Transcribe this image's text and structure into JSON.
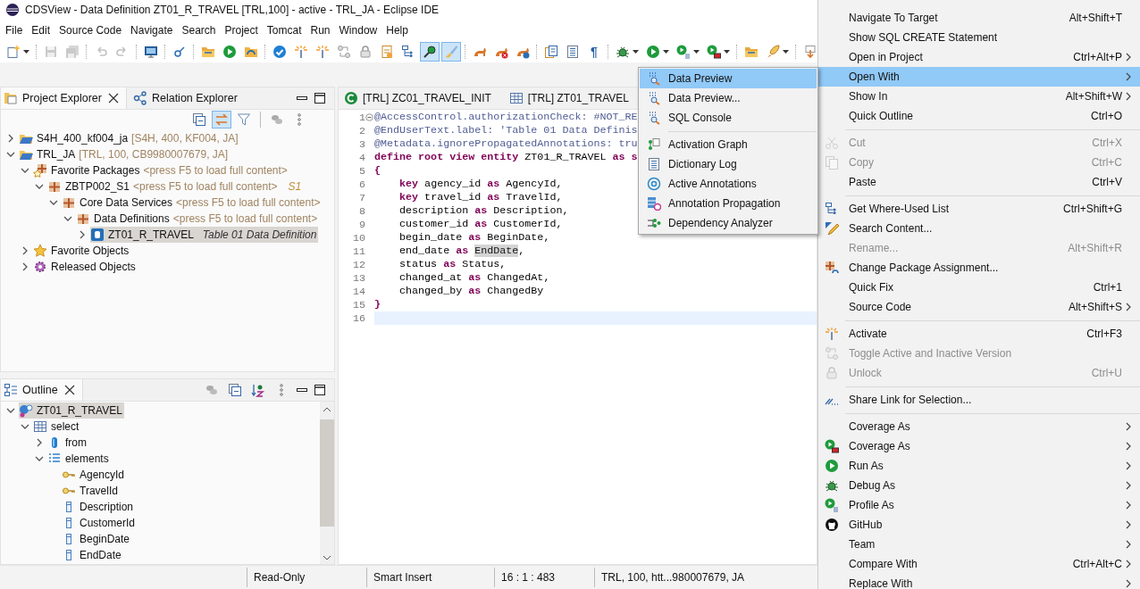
{
  "window": {
    "title": "CDSView - Data Definition ZT01_R_TRAVEL [TRL,100] - active - TRL_JA - Eclipse IDE"
  },
  "menu_bar": [
    "File",
    "Edit",
    "Source Code",
    "Navigate",
    "Search",
    "Project",
    "Tomcat",
    "Run",
    "Window",
    "Help"
  ],
  "toolbar": [
    {
      "kind": "newfile",
      "dropdown": true,
      "selected": false,
      "disabled": false
    },
    {
      "kind": "separator"
    },
    {
      "kind": "save",
      "dropdown": false,
      "selected": false,
      "disabled": true
    },
    {
      "kind": "saveall",
      "dropdown": false,
      "selected": false,
      "disabled": true
    },
    {
      "kind": "separator"
    },
    {
      "kind": "undo",
      "dropdown": false,
      "selected": false,
      "disabled": true
    },
    {
      "kind": "redo",
      "dropdown": false,
      "selected": false,
      "disabled": true
    },
    {
      "kind": "separator"
    },
    {
      "kind": "monitor",
      "dropdown": false,
      "selected": false,
      "disabled": false
    },
    {
      "kind": "separator"
    },
    {
      "kind": "link",
      "dropdown": false,
      "selected": false,
      "disabled": false
    },
    {
      "kind": "separator"
    },
    {
      "kind": "folder",
      "dropdown": false,
      "selected": false,
      "disabled": false
    },
    {
      "kind": "play",
      "dropdown": false,
      "selected": false,
      "disabled": false
    },
    {
      "kind": "foldersync",
      "dropdown": false,
      "selected": false,
      "disabled": false
    },
    {
      "kind": "separator"
    },
    {
      "kind": "check",
      "dropdown": false,
      "selected": false,
      "disabled": false
    },
    {
      "kind": "sparkle",
      "dropdown": false,
      "selected": false,
      "disabled": false
    },
    {
      "kind": "sparkle",
      "dropdown": false,
      "selected": false,
      "disabled": false
    },
    {
      "kind": "cycle",
      "dropdown": false,
      "selected": false,
      "disabled": false
    },
    {
      "kind": "lock",
      "dropdown": false,
      "selected": false,
      "disabled": false
    },
    {
      "kind": "docorange",
      "dropdown": false,
      "selected": false,
      "disabled": false
    },
    {
      "kind": "hierarchy",
      "dropdown": false,
      "selected": false,
      "disabled": false
    },
    {
      "kind": "searchtool",
      "dropdown": false,
      "selected": true,
      "disabled": false
    },
    {
      "kind": "brush",
      "dropdown": false,
      "selected": true,
      "disabled": false
    },
    {
      "kind": "separator"
    },
    {
      "kind": "cat",
      "dropdown": false,
      "selected": false,
      "disabled": false
    },
    {
      "kind": "catx",
      "dropdown": false,
      "selected": false,
      "disabled": false
    },
    {
      "kind": "catblue",
      "dropdown": false,
      "selected": false,
      "disabled": false
    },
    {
      "kind": "separator"
    },
    {
      "kind": "docs2",
      "dropdown": false,
      "selected": false,
      "disabled": false
    },
    {
      "kind": "listdoc",
      "dropdown": false,
      "selected": false,
      "disabled": false
    },
    {
      "kind": "text",
      "label": "¶",
      "dropdown": false,
      "selected": false,
      "disabled": false
    },
    {
      "kind": "separator"
    },
    {
      "kind": "bug",
      "dropdown": true,
      "selected": false,
      "disabled": false
    },
    {
      "kind": "play",
      "dropdown": true,
      "selected": false,
      "disabled": false
    },
    {
      "kind": "playdoc",
      "dropdown": true,
      "selected": false,
      "disabled": false
    },
    {
      "kind": "playred",
      "dropdown": true,
      "selected": false,
      "disabled": false
    },
    {
      "kind": "separator"
    },
    {
      "kind": "folder",
      "dropdown": false,
      "selected": false,
      "disabled": false
    },
    {
      "kind": "rocket",
      "dropdown": true,
      "selected": false,
      "disabled": false
    },
    {
      "kind": "separator"
    },
    {
      "kind": "down",
      "dropdown": true,
      "selected": false,
      "disabled": false
    }
  ],
  "project_explorer": {
    "tabs": [
      {
        "label": "Project Explorer",
        "kind": "explorer",
        "selected": true,
        "closable": true
      },
      {
        "label": "Relation Explorer",
        "kind": "relation",
        "selected": false,
        "closable": false
      }
    ],
    "toolbar": [
      {
        "kind": "collapse",
        "selected": false
      },
      {
        "kind": "syncarrows",
        "selected": true
      },
      {
        "kind": "filter",
        "selected": false
      },
      {
        "kind": "separator"
      },
      {
        "kind": "disks",
        "selected": false
      },
      {
        "kind": "more",
        "selected": false
      }
    ],
    "tree": [
      {
        "label": "S4H_400_kf004_ja",
        "decoration": "[S4H, 400, KF004, JA]",
        "kind": "projfolder",
        "expanded": false,
        "selected": false
      },
      {
        "label": "TRL_JA",
        "decoration": "[TRL, 100, CB9980007679, JA]",
        "kind": "projfolder",
        "expanded": true,
        "selected": false,
        "children": [
          {
            "label": "Favorite Packages",
            "decoration": "<press F5 to load full content>",
            "kind": "starpkg",
            "expanded": true,
            "selected": false,
            "children": [
              {
                "label": "ZBTP002_S1",
                "decoration": "<press F5 to load full content>",
                "suffix": "S1",
                "kind": "pkg",
                "expanded": true,
                "selected": false,
                "children": [
                  {
                    "label": "Core Data Services",
                    "decoration": "<press F5 to load full content>",
                    "kind": "pkg",
                    "expanded": true,
                    "selected": false,
                    "children": [
                      {
                        "label": "Data Definitions",
                        "decoration": "<press F5 to load full content>",
                        "kind": "pkg",
                        "expanded": true,
                        "selected": false,
                        "children": [
                          {
                            "label": "ZT01_R_TRAVEL",
                            "description": "Table 01 Data Definition",
                            "kind": "ddl",
                            "expanded": false,
                            "selected": true
                          }
                        ]
                      }
                    ]
                  }
                ]
              }
            ]
          },
          {
            "label": "Favorite Objects",
            "kind": "star",
            "expanded": false,
            "selected": false
          },
          {
            "label": "Released Objects",
            "kind": "gear",
            "expanded": false,
            "selected": false
          }
        ]
      }
    ]
  },
  "outline": {
    "tab": {
      "label": "Outline",
      "selected": true
    },
    "toolbar": [
      {
        "kind": "disks"
      },
      {
        "kind": "collapse"
      },
      {
        "kind": "sort"
      },
      {
        "kind": "more"
      }
    ],
    "tree": [
      {
        "label": "ZT01_R_TRAVEL",
        "kind": "entity",
        "expanded": true,
        "selected": true,
        "children": [
          {
            "label": "select",
            "kind": "table",
            "expanded": true,
            "selected": false,
            "children": [
              {
                "label": "from",
                "kind": "cylinder",
                "expanded": false,
                "selected": false
              },
              {
                "label": "elements",
                "kind": "list",
                "expanded": true,
                "selected": false,
                "children": [
                  {
                    "label": "AgencyId",
                    "kind": "key",
                    "selected": false
                  },
                  {
                    "label": "TravelId",
                    "kind": "key",
                    "selected": false
                  },
                  {
                    "label": "Description",
                    "kind": "field",
                    "selected": false
                  },
                  {
                    "label": "CustomerId",
                    "kind": "field",
                    "selected": false
                  },
                  {
                    "label": "BeginDate",
                    "kind": "field",
                    "selected": false
                  },
                  {
                    "label": "EndDate",
                    "kind": "field",
                    "selected": false
                  }
                ]
              }
            ]
          }
        ]
      }
    ]
  },
  "editor": {
    "tabs": [
      {
        "label": "[TRL] ZC01_TRAVEL_INIT",
        "kind": "classc",
        "selected": false
      },
      {
        "label": "[TRL] ZT01_TRAVEL",
        "kind": "table",
        "selected": false
      }
    ],
    "lines": [
      {
        "number": "1",
        "folding": true,
        "current": false,
        "tokens": [
          {
            "text": "@AccessControl.authorizationCheck: #NOT_RE",
            "kind": "annotation"
          }
        ]
      },
      {
        "number": "2",
        "current": false,
        "tokens": [
          {
            "text": "@EndUserText.label: 'Table 01 Data Definis",
            "kind": "annotation"
          }
        ]
      },
      {
        "number": "3",
        "current": false,
        "tokens": [
          {
            "text": "@Metadata.ignorePropagatedAnnotations: tru",
            "kind": "annotation"
          }
        ]
      },
      {
        "number": "4",
        "current": false,
        "tokens": [
          {
            "text": "define root view entity",
            "kind": "keyword"
          },
          {
            "text": " ZT01_R_TRAVEL ",
            "kind": "plain"
          },
          {
            "text": "as s",
            "kind": "keyword"
          }
        ]
      },
      {
        "number": "5",
        "current": false,
        "tokens": [
          {
            "text": "{",
            "kind": "keyword"
          }
        ]
      },
      {
        "number": "6",
        "current": false,
        "tokens": [
          {
            "text": "    key",
            "kind": "keyword"
          },
          {
            "text": " agency_id ",
            "kind": "plain"
          },
          {
            "text": "as",
            "kind": "keyword"
          },
          {
            "text": " AgencyId,",
            "kind": "plain"
          }
        ]
      },
      {
        "number": "7",
        "current": false,
        "tokens": [
          {
            "text": "    key",
            "kind": "keyword"
          },
          {
            "text": " travel_id ",
            "kind": "plain"
          },
          {
            "text": "as",
            "kind": "keyword"
          },
          {
            "text": " TravelId,",
            "kind": "plain"
          }
        ]
      },
      {
        "number": "8",
        "current": false,
        "tokens": [
          {
            "text": "    description ",
            "kind": "plain"
          },
          {
            "text": "as",
            "kind": "keyword"
          },
          {
            "text": " Description,",
            "kind": "plain"
          }
        ]
      },
      {
        "number": "9",
        "current": false,
        "tokens": [
          {
            "text": "    customer_id ",
            "kind": "plain"
          },
          {
            "text": "as",
            "kind": "keyword"
          },
          {
            "text": " CustomerId,",
            "kind": "plain"
          }
        ]
      },
      {
        "number": "10",
        "current": false,
        "tokens": [
          {
            "text": "    begin_date ",
            "kind": "plain"
          },
          {
            "text": "as",
            "kind": "keyword"
          },
          {
            "text": " BeginDate,",
            "kind": "plain"
          }
        ]
      },
      {
        "number": "11",
        "current": false,
        "tokens": [
          {
            "text": "    end_date ",
            "kind": "plain"
          },
          {
            "text": "as ",
            "kind": "keyword"
          },
          {
            "text": "EndDate",
            "kind": "occurrence"
          },
          {
            "text": ",",
            "kind": "plain"
          }
        ]
      },
      {
        "number": "12",
        "current": false,
        "tokens": [
          {
            "text": "    status ",
            "kind": "plain"
          },
          {
            "text": "as",
            "kind": "keyword"
          },
          {
            "text": " Status,",
            "kind": "plain"
          }
        ]
      },
      {
        "number": "13",
        "current": false,
        "tokens": [
          {
            "text": "    changed_at ",
            "kind": "plain"
          },
          {
            "text": "as",
            "kind": "keyword"
          },
          {
            "text": " ChangedAt,",
            "kind": "plain"
          }
        ]
      },
      {
        "number": "14",
        "current": false,
        "tokens": [
          {
            "text": "    changed_by ",
            "kind": "plain"
          },
          {
            "text": "as",
            "kind": "keyword"
          },
          {
            "text": " ChangedBy",
            "kind": "plain"
          }
        ]
      },
      {
        "number": "15",
        "current": false,
        "tokens": [
          {
            "text": "}",
            "kind": "keyword"
          }
        ]
      },
      {
        "number": "16",
        "current": true
      }
    ]
  },
  "status_bar": [
    "Read-Only",
    "Smart Insert",
    "16 : 1 : 483",
    "TRL, 100, htt...980007679, JA"
  ],
  "context_menu": {
    "items": [
      {
        "kind": "text",
        "label": "Navigate To Target",
        "shortcut": "Alt+Shift+T",
        "submenu": false,
        "disabled": false,
        "selected": false
      },
      {
        "kind": "text",
        "label": "Show SQL CREATE Statement",
        "submenu": false,
        "disabled": false,
        "selected": false
      },
      {
        "kind": "text",
        "label": "Open in Project",
        "shortcut": "Ctrl+Alt+P",
        "submenu": true,
        "disabled": false,
        "selected": false
      },
      {
        "kind": "text",
        "label": "Open With",
        "submenu": true,
        "disabled": false,
        "selected": true
      },
      {
        "kind": "text",
        "label": "Show In",
        "shortcut": "Alt+Shift+W",
        "submenu": true,
        "disabled": false,
        "selected": false
      },
      {
        "kind": "text",
        "label": "Quick Outline",
        "shortcut": "Ctrl+O",
        "submenu": false,
        "disabled": false,
        "selected": false
      },
      {
        "kind": "separator"
      },
      {
        "kind": "scissors",
        "label": "Cut",
        "shortcut": "Ctrl+X",
        "submenu": false,
        "disabled": true,
        "selected": false
      },
      {
        "kind": "copy",
        "label": "Copy",
        "shortcut": "Ctrl+C",
        "submenu": false,
        "disabled": true,
        "selected": false
      },
      {
        "kind": "text",
        "label": "Paste",
        "shortcut": "Ctrl+V",
        "submenu": false,
        "disabled": false,
        "selected": false
      },
      {
        "kind": "separator"
      },
      {
        "kind": "hierarchy",
        "label": "Get Where-Used List",
        "shortcut": "Ctrl+Shift+G",
        "submenu": false,
        "disabled": false,
        "selected": false
      },
      {
        "kind": "pen",
        "label": "Search Content...",
        "submenu": false,
        "disabled": false,
        "selected": false
      },
      {
        "kind": "text",
        "label": "Rename...",
        "shortcut": "Alt+Shift+R",
        "submenu": false,
        "disabled": true,
        "selected": false
      },
      {
        "kind": "pkgchange",
        "label": "Change Package Assignment...",
        "submenu": false,
        "disabled": false,
        "selected": false
      },
      {
        "kind": "text",
        "label": "Quick Fix",
        "shortcut": "Ctrl+1",
        "submenu": false,
        "disabled": false,
        "selected": false
      },
      {
        "kind": "text",
        "label": "Source Code",
        "shortcut": "Alt+Shift+S",
        "submenu": true,
        "disabled": false,
        "selected": false
      },
      {
        "kind": "separator"
      },
      {
        "kind": "sparkle",
        "label": "Activate",
        "shortcut": "Ctrl+F3",
        "submenu": false,
        "disabled": false,
        "selected": false
      },
      {
        "kind": "cycle",
        "label": "Toggle Active and Inactive Version",
        "submenu": false,
        "disabled": true,
        "selected": false
      },
      {
        "kind": "lock",
        "label": "Unlock",
        "shortcut": "Ctrl+U",
        "submenu": false,
        "disabled": true,
        "selected": false
      },
      {
        "kind": "separator"
      },
      {
        "kind": "share",
        "label": "Share Link for Selection...",
        "submenu": false,
        "disabled": false,
        "selected": false
      },
      {
        "kind": "separator"
      },
      {
        "kind": "text",
        "label": "Coverage As",
        "submenu": true,
        "disabled": false,
        "selected": false
      },
      {
        "kind": "playred",
        "label": "Coverage As",
        "submenu": true,
        "disabled": false,
        "selected": false
      },
      {
        "kind": "play",
        "label": "Run As",
        "submenu": true,
        "disabled": false,
        "selected": false
      },
      {
        "kind": "bug",
        "label": "Debug As",
        "submenu": true,
        "disabled": false,
        "selected": false
      },
      {
        "kind": "playdoc",
        "label": "Profile As",
        "submenu": true,
        "disabled": false,
        "selected": false
      },
      {
        "kind": "blackcircle",
        "label": "GitHub",
        "submenu": true,
        "disabled": false,
        "selected": false
      },
      {
        "kind": "text",
        "label": "Team",
        "submenu": true,
        "disabled": false,
        "selected": false
      },
      {
        "kind": "text",
        "label": "Compare With",
        "shortcut": "Ctrl+Alt+C",
        "submenu": true,
        "disabled": false,
        "selected": false
      },
      {
        "kind": "text",
        "label": "Replace With",
        "submenu": true,
        "disabled": false,
        "selected": false
      }
    ]
  },
  "submenu": {
    "items": [
      {
        "kind": "magnifier",
        "label": "Data Preview",
        "selected": true
      },
      {
        "kind": "magnifier",
        "label": "Data Preview...",
        "selected": false
      },
      {
        "kind": "magnifier",
        "label": "SQL Console",
        "selected": false
      },
      {
        "kind": "separator"
      },
      {
        "kind": "graph",
        "label": "Activation Graph",
        "selected": false
      },
      {
        "kind": "listdoc",
        "label": "Dictionary Log",
        "selected": false
      },
      {
        "kind": "at",
        "label": "Active Annotations",
        "selected": false
      },
      {
        "kind": "propagation",
        "label": "Annotation Propagation",
        "selected": false
      },
      {
        "kind": "dependency",
        "label": "Dependency Analyzer",
        "selected": false
      }
    ]
  }
}
